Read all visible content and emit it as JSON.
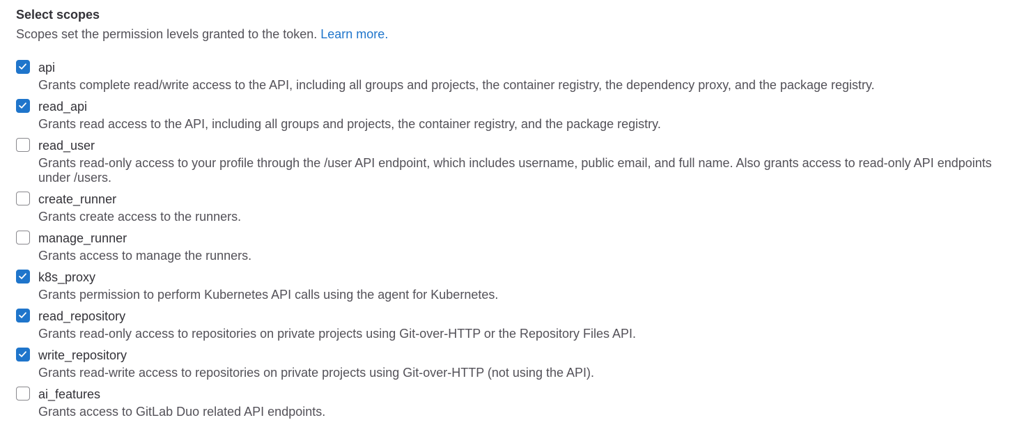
{
  "section": {
    "title": "Select scopes",
    "subtitle": "Scopes set the permission levels granted to the token.",
    "learn_more": "Learn more."
  },
  "colors": {
    "accent": "#1f75cb",
    "text_primary": "#333238",
    "text_secondary": "#535158"
  },
  "scopes": [
    {
      "name": "api",
      "checked": true,
      "description": "Grants complete read/write access to the API, including all groups and projects, the container registry, the dependency proxy, and the package registry."
    },
    {
      "name": "read_api",
      "checked": true,
      "description": "Grants read access to the API, including all groups and projects, the container registry, and the package registry."
    },
    {
      "name": "read_user",
      "checked": false,
      "description": "Grants read-only access to your profile through the /user API endpoint, which includes username, public email, and full name. Also grants access to read-only API endpoints under /users."
    },
    {
      "name": "create_runner",
      "checked": false,
      "description": "Grants create access to the runners."
    },
    {
      "name": "manage_runner",
      "checked": false,
      "description": "Grants access to manage the runners."
    },
    {
      "name": "k8s_proxy",
      "checked": true,
      "description": "Grants permission to perform Kubernetes API calls using the agent for Kubernetes."
    },
    {
      "name": "read_repository",
      "checked": true,
      "description": "Grants read-only access to repositories on private projects using Git-over-HTTP or the Repository Files API."
    },
    {
      "name": "write_repository",
      "checked": true,
      "description": "Grants read-write access to repositories on private projects using Git-over-HTTP (not using the API)."
    },
    {
      "name": "ai_features",
      "checked": false,
      "description": "Grants access to GitLab Duo related API endpoints."
    }
  ]
}
